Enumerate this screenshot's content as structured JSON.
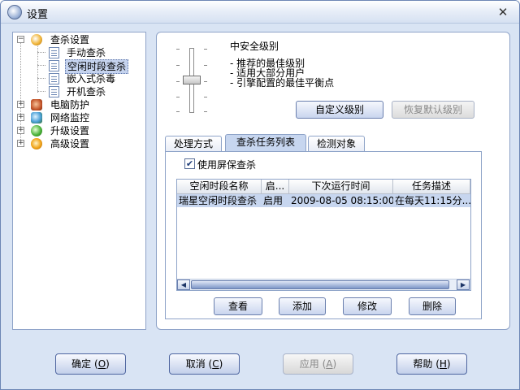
{
  "window": {
    "title": "设置",
    "close_glyph": "✕"
  },
  "tree": {
    "items": [
      {
        "label": "查杀设置",
        "icon": "magnifier-bug-icon"
      },
      {
        "label": "手动查杀",
        "icon": "document-icon"
      },
      {
        "label": "空闲时段查杀",
        "icon": "document-icon",
        "selected": true
      },
      {
        "label": "嵌入式杀毒",
        "icon": "document-icon"
      },
      {
        "label": "开机查杀",
        "icon": "document-icon"
      },
      {
        "label": "电脑防护",
        "icon": "glove-icon"
      },
      {
        "label": "网络监控",
        "icon": "network-icon"
      },
      {
        "label": "升级设置",
        "icon": "upgrade-check-icon"
      },
      {
        "label": "高级设置",
        "icon": "gear-icon"
      }
    ]
  },
  "security_level": {
    "title": "中安全级别",
    "lines": [
      "- 推荐的最佳级别",
      "- 适用大部分用户",
      "- 引擎配置的最佳平衡点"
    ],
    "custom_button": "自定义级别",
    "restore_button": "恢复默认级别"
  },
  "tabs": [
    "处理方式",
    "查杀任务列表",
    "检测对象"
  ],
  "screensaver": {
    "label": "使用屏保查杀",
    "checked": true
  },
  "task_list": {
    "columns": [
      "空闲时段名称",
      "启...",
      "下次运行时间",
      "任务描述"
    ],
    "rows": [
      {
        "name": "瑞星空闲时段查杀",
        "status": "启用",
        "next_run": "2009-08-05 08:15:00",
        "desc": "在每天11:15分..."
      }
    ]
  },
  "list_buttons": {
    "view": "查看",
    "add": "添加",
    "modify": "修改",
    "delete": "删除"
  },
  "dialog_buttons": {
    "ok": "确定",
    "ok_key": "O",
    "cancel": "取消",
    "cancel_key": "C",
    "apply": "应用",
    "apply_key": "A",
    "help": "帮助",
    "help_key": "H"
  },
  "colors": {
    "accent": "#8ea3c8",
    "selection": "#c7d6ef",
    "background": "#d9e4f4"
  }
}
